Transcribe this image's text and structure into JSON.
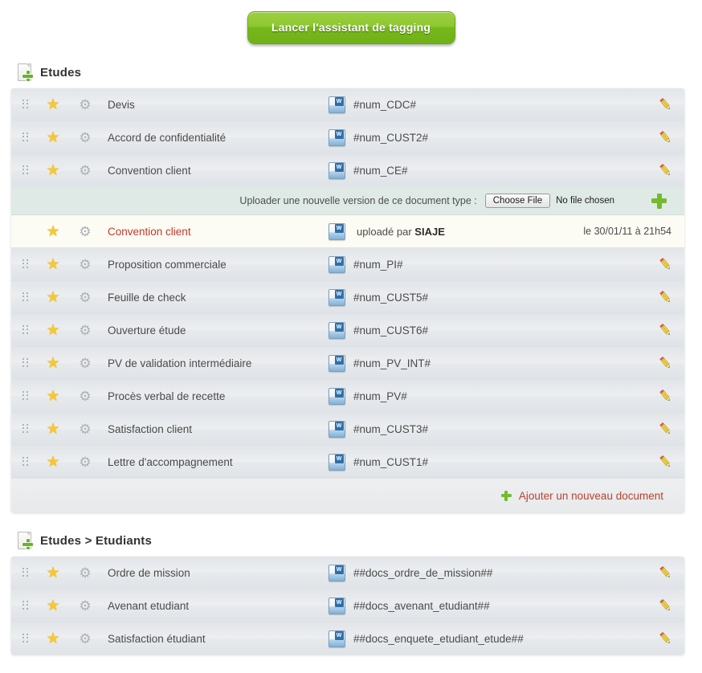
{
  "toolbar": {
    "launch_button": "Lancer l'assistant de tagging"
  },
  "sections": [
    {
      "title": "Etudes",
      "icon": "document-add-icon",
      "footer_label": "Ajouter un nouveau document",
      "rows": [
        {
          "name": "Devis",
          "tag": "#num_CDC#"
        },
        {
          "name": "Accord de confidentialité",
          "tag": "#num_CUST2#"
        },
        {
          "name": "Convention client",
          "tag": "#num_CE#"
        },
        {
          "name": "Proposition commerciale",
          "tag": "#num_PI#"
        },
        {
          "name": "Feuille de check",
          "tag": "#num_CUST5#"
        },
        {
          "name": "Ouverture étude",
          "tag": "#num_CUST6#"
        },
        {
          "name": "PV de validation intermédiaire",
          "tag": "#num_PV_INT#"
        },
        {
          "name": "Procès verbal de recette",
          "tag": "#num_PV#"
        },
        {
          "name": "Satisfaction client",
          "tag": "#num_CUST3#"
        },
        {
          "name": "Lettre d'accompagnement",
          "tag": "#num_CUST1#"
        }
      ],
      "upload": {
        "label": "Uploader une nouvelle version de ce document type :",
        "choose_file_button": "Choose File",
        "file_status": "No file chosen"
      },
      "uploaded": {
        "name": "Convention client",
        "uploaded_by_prefix": "uploadé par",
        "uploaded_by_user": "SIAJE",
        "when": "le 30/01/11 à 21h54"
      }
    },
    {
      "title": "Etudes > Etudiants",
      "icon": "document-add-icon",
      "rows": [
        {
          "name": "Ordre de mission",
          "tag": "##docs_ordre_de_mission##"
        },
        {
          "name": "Avenant etudiant",
          "tag": "##docs_avenant_etudiant##"
        },
        {
          "name": "Satisfaction étudiant",
          "tag": "##docs_enquete_etudiant_etude##"
        }
      ]
    }
  ],
  "icons": {
    "drag": "drag-handle-icon",
    "star": "star-icon",
    "gear": "gear-icon",
    "doc": "word-document-icon",
    "edit": "pencil-edit-icon",
    "plus": "plus-icon"
  },
  "colors": {
    "accent_green": "#74bb2b",
    "link_red": "#b9422f",
    "highlight_row": "#fdfcf4",
    "upload_row": "#dfeae7"
  }
}
